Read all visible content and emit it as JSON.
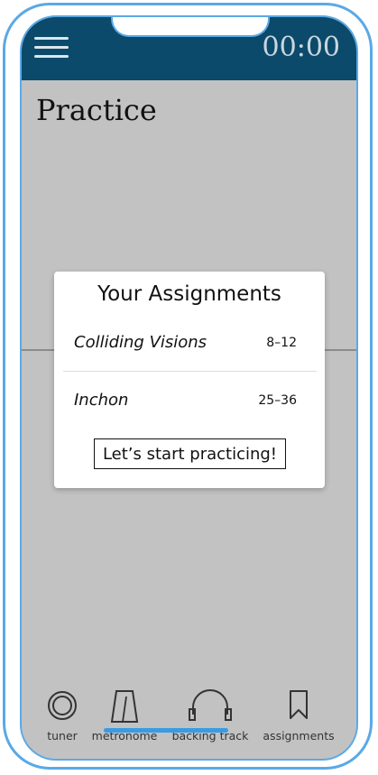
{
  "header": {
    "menu_icon": "hamburger-menu-icon",
    "timer": "00:00",
    "background_color": "#0b4a6b"
  },
  "page": {
    "title": "Practice",
    "background_color": "#c2c2c2"
  },
  "modal": {
    "title": "Your Assignments",
    "assignments": [
      {
        "name": "Colliding Visions",
        "range": "8–12"
      },
      {
        "name": "Inchon",
        "range": "25–36"
      }
    ],
    "start_button": "Let’s start practicing!"
  },
  "tabbar": {
    "items": [
      {
        "label": "tuner",
        "icon": "tuner-icon"
      },
      {
        "label": "metronome",
        "icon": "metronome-icon"
      },
      {
        "label": "backing track",
        "icon": "headphones-icon"
      },
      {
        "label": "assignments",
        "icon": "bookmark-icon"
      }
    ]
  },
  "colors": {
    "device_outline": "#5aa9e6",
    "home_indicator": "#3b9be2"
  }
}
